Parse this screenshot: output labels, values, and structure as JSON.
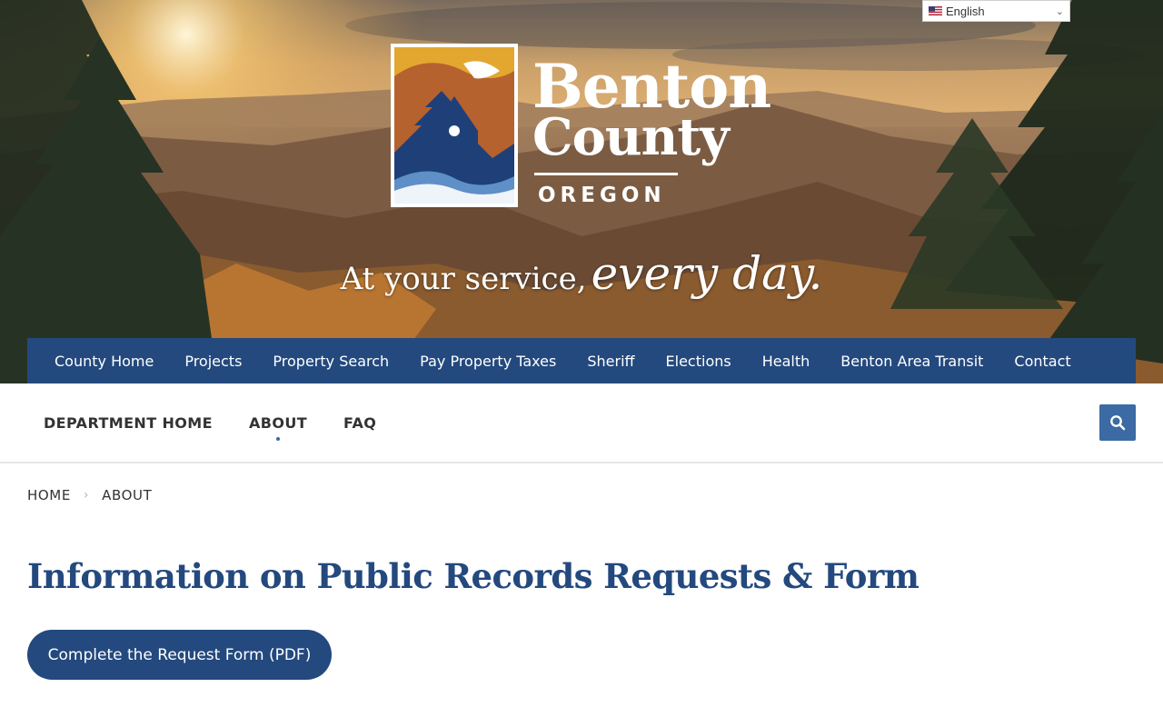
{
  "language_selector": {
    "selected": "English",
    "flag_icon": "us-flag-icon"
  },
  "brand": {
    "line1": "Benton",
    "line2": "County",
    "line3": "OREGON"
  },
  "tagline": {
    "part1": "At your service,",
    "part2": "every day."
  },
  "top_nav": {
    "items": [
      {
        "label": "County Home"
      },
      {
        "label": "Projects"
      },
      {
        "label": "Property Search"
      },
      {
        "label": "Pay Property Taxes"
      },
      {
        "label": "Sheriff"
      },
      {
        "label": "Elections"
      },
      {
        "label": "Health"
      },
      {
        "label": "Benton Area Transit"
      },
      {
        "label": "Contact"
      }
    ]
  },
  "dept_nav": {
    "items": [
      {
        "label": "DEPARTMENT HOME"
      },
      {
        "label": "ABOUT",
        "active": true
      },
      {
        "label": "FAQ"
      }
    ],
    "search_icon": "search-icon"
  },
  "breadcrumb": {
    "home": "HOME",
    "current": "ABOUT"
  },
  "main": {
    "title": "Information on Public Records Requests & Form",
    "cta_label": "Complete the Request Form (PDF)"
  },
  "colors": {
    "nav_blue": "#23497e",
    "accent_blue": "#3b6aa4",
    "logo_gold": "#e3a72f",
    "logo_rust": "#b5622e",
    "logo_navy": "#1f3f78"
  }
}
